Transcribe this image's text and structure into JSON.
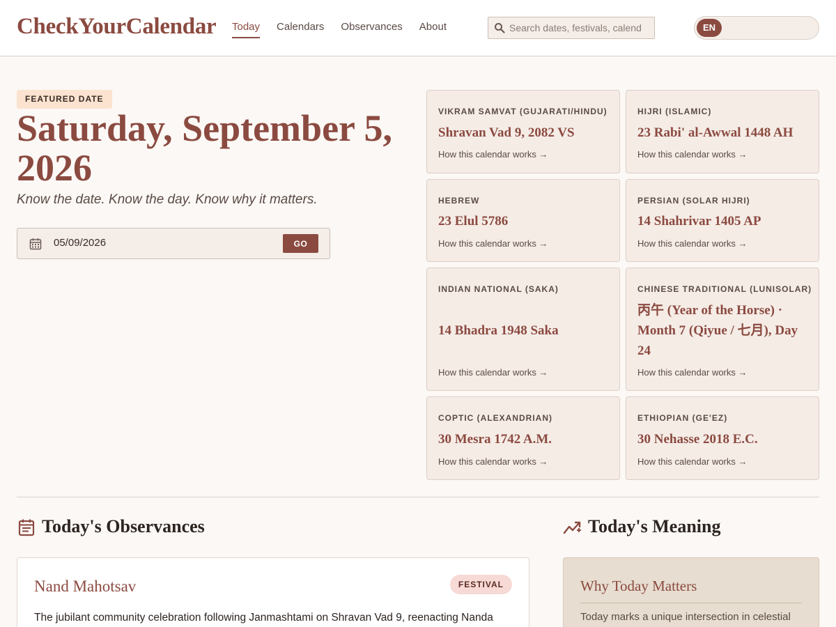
{
  "header": {
    "logo": "CheckYourCalendar",
    "nav": [
      {
        "label": "Today",
        "active": true
      },
      {
        "label": "Calendars",
        "active": false
      },
      {
        "label": "Observances",
        "active": false
      },
      {
        "label": "About",
        "active": false
      }
    ],
    "search_placeholder": "Search dates, festivals, calendars",
    "language": "EN"
  },
  "hero": {
    "badge": "FEATURED DATE",
    "date": "Saturday, September 5, 2026",
    "tagline": "Know the date. Know the day. Know why it matters.",
    "date_input_value": "05/09/2026",
    "go_label": "GO"
  },
  "calendars": [
    {
      "label": "VIKRAM SAMVAT (GUJARATI/HINDU)",
      "value": "Shravan Vad 9, 2082 VS",
      "link": "How this calendar works →"
    },
    {
      "label": "HIJRI (ISLAMIC)",
      "value": "23 Rabi' al-Awwal 1448 AH",
      "link": "How this calendar works →"
    },
    {
      "label": "HEBREW",
      "value": "23 Elul 5786",
      "link": "How this calendar works →"
    },
    {
      "label": "PERSIAN (SOLAR HIJRI)",
      "value": "14 Shahrivar 1405 AP",
      "link": "How this calendar works →"
    },
    {
      "label": "INDIAN NATIONAL (SAKA)",
      "value": "14 Bhadra 1948 Saka",
      "link": "How this calendar works →"
    },
    {
      "label": "CHINESE TRADITIONAL (LUNISOLAR)",
      "value": "丙午 (Year of the Horse) · Month 7 (Qiyue / 七月), Day 24",
      "link": "How this calendar works →"
    },
    {
      "label": "COPTIC (ALEXANDRIAN)",
      "value": "30 Mesra 1742 A.M.",
      "link": "How this calendar works →"
    },
    {
      "label": "ETHIOPIAN (GE'EZ)",
      "value": "30 Nehasse 2018 E.C.",
      "link": "How this calendar works →"
    }
  ],
  "observances": {
    "heading": "Today's Observances",
    "items": [
      {
        "title": "Nand Mahotsav",
        "tag": "FESTIVAL",
        "description": "The jubilant community celebration following Janmashtami on Shravan Vad 9, reenacting Nanda"
      }
    ]
  },
  "meaning": {
    "heading": "Today's Meaning",
    "card_title": "Why Today Matters",
    "text": "Today marks a unique intersection in celestial"
  },
  "colors": {
    "brand": "#8b4a40",
    "background": "#fbf8f5",
    "card": "#f5ece6",
    "badge": "#fbe3cf",
    "meaning_card": "#e7ddd0"
  },
  "icons": [
    "search-icon",
    "calendar-icon",
    "observances-icon",
    "meaning-icon"
  ]
}
